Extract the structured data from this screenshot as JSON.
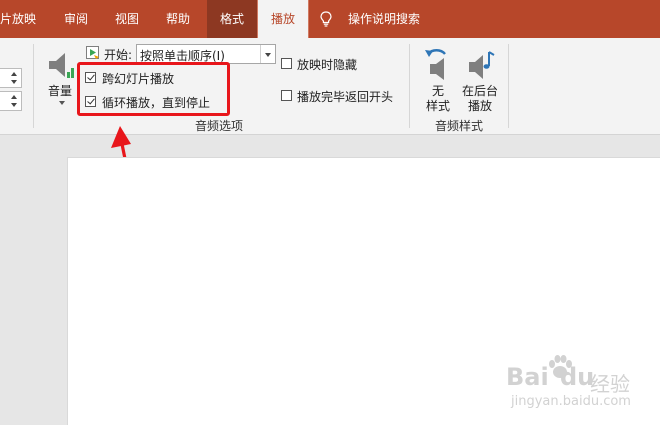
{
  "ribbon_tabs": {
    "slideshow": "片放映",
    "review": "审阅",
    "view": "视图",
    "help": "帮助",
    "format": "格式",
    "playback": "播放",
    "tell_me": "操作说明搜索"
  },
  "colors": {
    "tab_bar": "#b7472a",
    "context_tab": "#8d3822",
    "highlight_box": "#e8161b",
    "arrow": "#e8161b",
    "ribbon_bg": "#f3f3f3"
  },
  "audio_options": {
    "volume_label": "音量",
    "start_label": "开始:",
    "start_value": "按照单击顺序(I)",
    "play_across_slides": {
      "label": "跨幻灯片播放",
      "checked": true
    },
    "loop_until_stopped": {
      "label": "循环播放，直到停止",
      "checked": true
    },
    "hide_during_show": {
      "label": "放映时隐藏",
      "checked": false
    },
    "rewind_after_playing": {
      "label": "播放完毕返回开头",
      "checked": false
    },
    "group_label": "音频选项"
  },
  "audio_styles": {
    "no_style_line1": "无",
    "no_style_line2": "样式",
    "play_bg_line1": "在后台",
    "play_bg_line2": "播放",
    "group_label": "音频样式"
  },
  "watermark": {
    "brand": "Bai",
    "brand2": "du",
    "sub": "经验",
    "url": "jingyan.baidu.com"
  },
  "icons": [
    "lightbulb-icon",
    "volume-icon",
    "play-icon",
    "undo-icon",
    "speaker-note-icon",
    "dropdown-arrow-icon",
    "paw-icon"
  ]
}
